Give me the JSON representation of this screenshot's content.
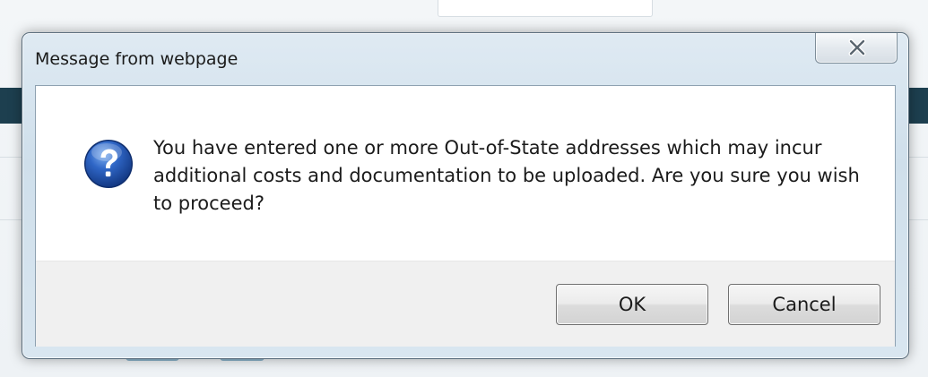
{
  "dialog": {
    "title": "Message from webpage",
    "message": "You have entered one or more Out-of-State addresses which may incur additional costs and documentation to be uploaded. Are you sure you wish to proceed?",
    "icon": "question-icon",
    "buttons": {
      "ok_label": "OK",
      "cancel_label": "Cancel"
    },
    "close_icon": "close-icon"
  },
  "colors": {
    "icon_blue": "#2a5fb8",
    "background_accent": "#1d3f4f"
  }
}
